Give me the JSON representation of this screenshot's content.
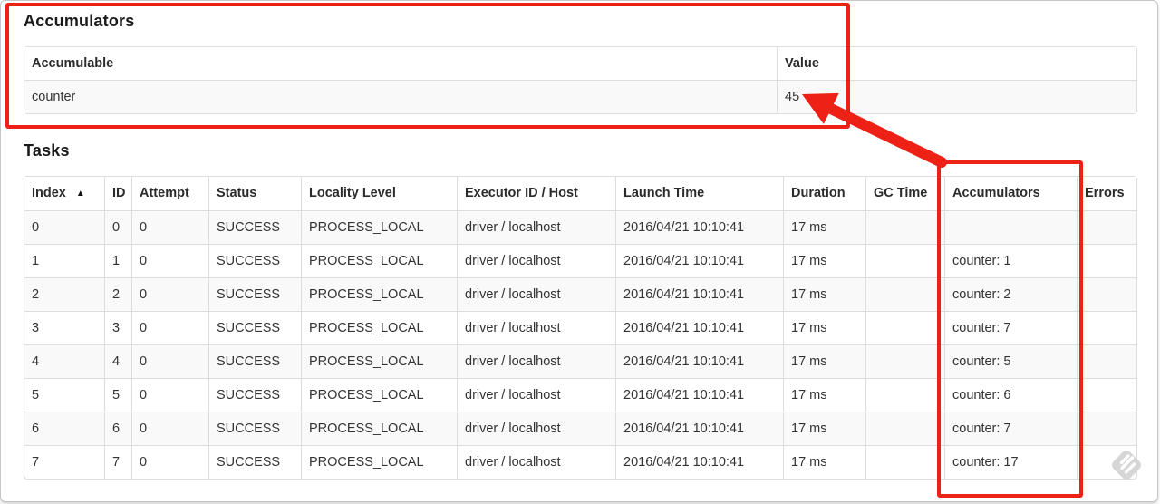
{
  "accumulators": {
    "title": "Accumulators",
    "columns": [
      "Accumulable",
      "Value"
    ],
    "rows": [
      [
        "counter",
        "45"
      ]
    ]
  },
  "tasks": {
    "title": "Tasks",
    "sort_icon": "▲",
    "sorted_column": "Index",
    "columns": [
      "Index",
      "ID",
      "Attempt",
      "Status",
      "Locality Level",
      "Executor ID / Host",
      "Launch Time",
      "Duration",
      "GC Time",
      "Accumulators",
      "Errors"
    ],
    "rows": [
      [
        "0",
        "0",
        "0",
        "SUCCESS",
        "PROCESS_LOCAL",
        "driver / localhost",
        "2016/04/21 10:10:41",
        "17 ms",
        "",
        "",
        ""
      ],
      [
        "1",
        "1",
        "0",
        "SUCCESS",
        "PROCESS_LOCAL",
        "driver / localhost",
        "2016/04/21 10:10:41",
        "17 ms",
        "",
        "counter: 1",
        ""
      ],
      [
        "2",
        "2",
        "0",
        "SUCCESS",
        "PROCESS_LOCAL",
        "driver / localhost",
        "2016/04/21 10:10:41",
        "17 ms",
        "",
        "counter: 2",
        ""
      ],
      [
        "3",
        "3",
        "0",
        "SUCCESS",
        "PROCESS_LOCAL",
        "driver / localhost",
        "2016/04/21 10:10:41",
        "17 ms",
        "",
        "counter: 7",
        ""
      ],
      [
        "4",
        "4",
        "0",
        "SUCCESS",
        "PROCESS_LOCAL",
        "driver / localhost",
        "2016/04/21 10:10:41",
        "17 ms",
        "",
        "counter: 5",
        ""
      ],
      [
        "5",
        "5",
        "0",
        "SUCCESS",
        "PROCESS_LOCAL",
        "driver / localhost",
        "2016/04/21 10:10:41",
        "17 ms",
        "",
        "counter: 6",
        ""
      ],
      [
        "6",
        "6",
        "0",
        "SUCCESS",
        "PROCESS_LOCAL",
        "driver / localhost",
        "2016/04/21 10:10:41",
        "17 ms",
        "",
        "counter: 7",
        ""
      ],
      [
        "7",
        "7",
        "0",
        "SUCCESS",
        "PROCESS_LOCAL",
        "driver / localhost",
        "2016/04/21 10:10:41",
        "17 ms",
        "",
        "counter: 17",
        ""
      ]
    ]
  },
  "annotations": {
    "color": "#ee2117",
    "arrow_points_to": "45"
  },
  "colors": {
    "stripe_row": "#f9f9f9",
    "table_border": "#dddddd",
    "text": "#333333"
  },
  "watermark": {
    "icon": "skitch-watermark-icon"
  }
}
